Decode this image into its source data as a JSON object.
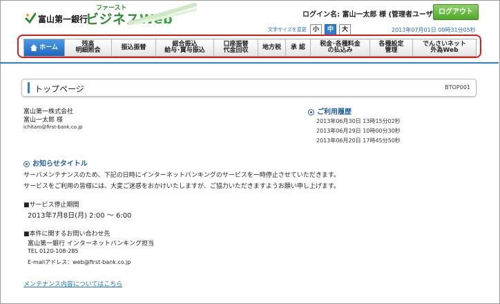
{
  "header": {
    "bank_name": "富山第一銀行",
    "logo_sub": "ファースト",
    "logo_main": "ビジネス",
    "logo_web": "Web",
    "login_name": "ログイン名: 富山一太郎 様 (管理者ユーザ)",
    "logout_label": "ログアウト",
    "fontsize_label": "文字サイズを変更",
    "fontsize_small": "小",
    "fontsize_medium": "中",
    "fontsize_large": "大",
    "datetime": "2013年07月01日 09時31分05秒"
  },
  "nav": {
    "home": "ホーム",
    "balance": "残高\n明細照会",
    "transfer": "振込振替",
    "bulk_transfer": "総合振込\n給与･賞与振込",
    "account_transfer": "口座振替\n代金回収",
    "local_tax": "地方税",
    "approval": "承 認",
    "tax_payment": "税金･各種料金\nの払込み",
    "settings": "各種設定\n管理",
    "densai": "でんさいネット\n外為Web"
  },
  "page": {
    "title": "トップページ",
    "screen_id": "BTOP001"
  },
  "user": {
    "company": "富山第一株式会社",
    "name": "富山一太郎 様",
    "email": "ichitaro@first-bank.co.jp"
  },
  "history": {
    "heading": "ご利用履歴",
    "entries": [
      "2013年06月30日 13時15分02秒",
      "2013年06月29日 10時00分30秒",
      "2013年06月20日 17時45分50秒"
    ]
  },
  "notice": {
    "heading": "お知らせタイトル",
    "line1": "サーバメンテナンスのため、下記の日時にインターネットバンキングのサービスを一時停止させていただきます。",
    "line2": "サービスをご利用の皆様には、大変ご迷惑をおかけいたしますが、ご協力いただきますようお願い申し上げます。",
    "stop_heading": "■サービス停止期間",
    "stop_period": "2013年7月8日(月) 2:00 ～ 6:00",
    "contact_heading": "■本件に関するお問い合わせ先",
    "contact_name": "富山第一銀行 インターネットバンキング担当",
    "tel": "TEL 0120-108-285",
    "email": "E-mailアドレス：web@first-bank.co.jp",
    "link": "メンテナンス内容についてはこちら"
  },
  "colors": {
    "accent_blue": "#2a7fd4",
    "logo_green": "#2f8a2f",
    "logout_green": "#4ea82a",
    "highlight_red": "#e01818"
  }
}
